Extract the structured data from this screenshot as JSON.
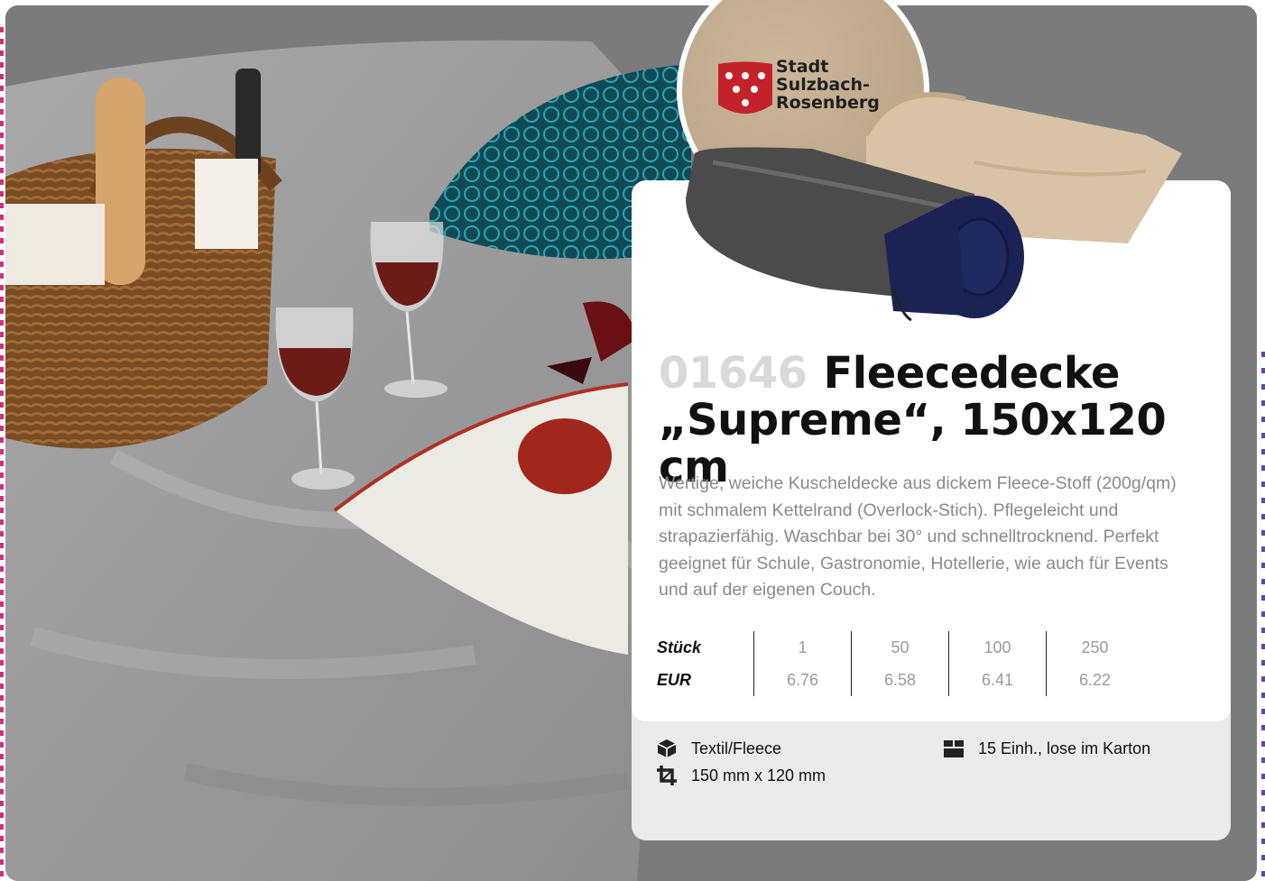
{
  "product": {
    "article_number": "01646",
    "title_line1": "Fleecedecke",
    "title_line2": "„Supreme“, 150x120 cm",
    "description": "Wertige, weiche Kuscheldecke aus dickem Fleece-Stoff (200g/qm) mit schmalem Kettelrand (Overlock-Stich). Pflegeleicht und strapazierfähig. Waschbar bei 30° und schnelltrocknend. Perfekt geeignet für Schule, Gastronomie, Hotellerie, wie auch für Events und auf der eigenen Couch."
  },
  "logo": {
    "lines": [
      "Stadt",
      "Sulzbach-",
      "Rosenberg"
    ]
  },
  "price_table": {
    "quantity_label": "Stück",
    "currency_label": "EUR",
    "quantities": [
      "1",
      "50",
      "100",
      "250"
    ],
    "prices": [
      "6.76",
      "6.58",
      "6.41",
      "6.22"
    ]
  },
  "specs": {
    "material": "Textil/Fleece",
    "size": "150 mm x 120 mm",
    "packaging": "15 Einh., lose im Karton"
  },
  "icons": {
    "material": "box-icon",
    "size": "crop-icon",
    "packaging": "package-icon"
  }
}
